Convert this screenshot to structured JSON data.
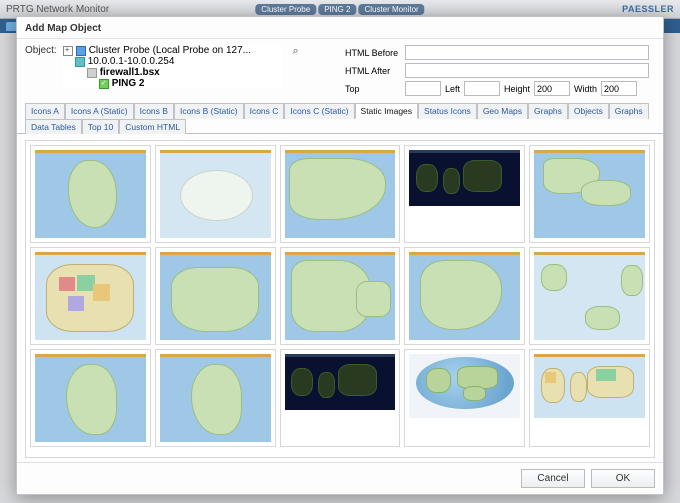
{
  "app": {
    "header_title": "PRTG Network Monitor",
    "logo": "PAESSLER",
    "status_tags": [
      "Cluster Probe",
      "PING 2",
      "Cluster Monitor"
    ]
  },
  "dialog": {
    "title": "Add Map Object",
    "object_label": "Object:",
    "tree": {
      "root": "Cluster Probe (Local Probe on 127...",
      "group": "10.0.0.1-10.0.0.254",
      "device": "firewall1.bsx",
      "sensor": "PING 2"
    },
    "fields": {
      "html_before_label": "HTML Before",
      "html_before_value": "",
      "html_after_label": "HTML After",
      "html_after_value": "",
      "top_label": "Top",
      "top_value": "",
      "left_label": "Left",
      "left_value": "",
      "height_label": "Height",
      "height_value": "200",
      "width_label": "Width",
      "width_value": "200"
    },
    "tabs": [
      "Icons A",
      "Icons A (Static)",
      "Icons B",
      "Icons B (Static)",
      "Icons C",
      "Icons C (Static)",
      "Static Images",
      "Status Icons",
      "Geo Maps",
      "Graphs",
      "Objects",
      "Graphs",
      "Data Tables",
      "Top 10",
      "Custom HTML"
    ],
    "active_tab_index": 6,
    "images": [
      {
        "name": "africa"
      },
      {
        "name": "arctic"
      },
      {
        "name": "asia"
      },
      {
        "name": "world-satellite-night"
      },
      {
        "name": "central-america"
      },
      {
        "name": "europe-political"
      },
      {
        "name": "europe"
      },
      {
        "name": "middle-east"
      },
      {
        "name": "north-america"
      },
      {
        "name": "pacific"
      },
      {
        "name": "south-america"
      },
      {
        "name": "south-america-2"
      },
      {
        "name": "world-satellite-night-2"
      },
      {
        "name": "world-globe"
      },
      {
        "name": "world-political"
      }
    ],
    "buttons": {
      "cancel": "Cancel",
      "ok": "OK"
    }
  }
}
